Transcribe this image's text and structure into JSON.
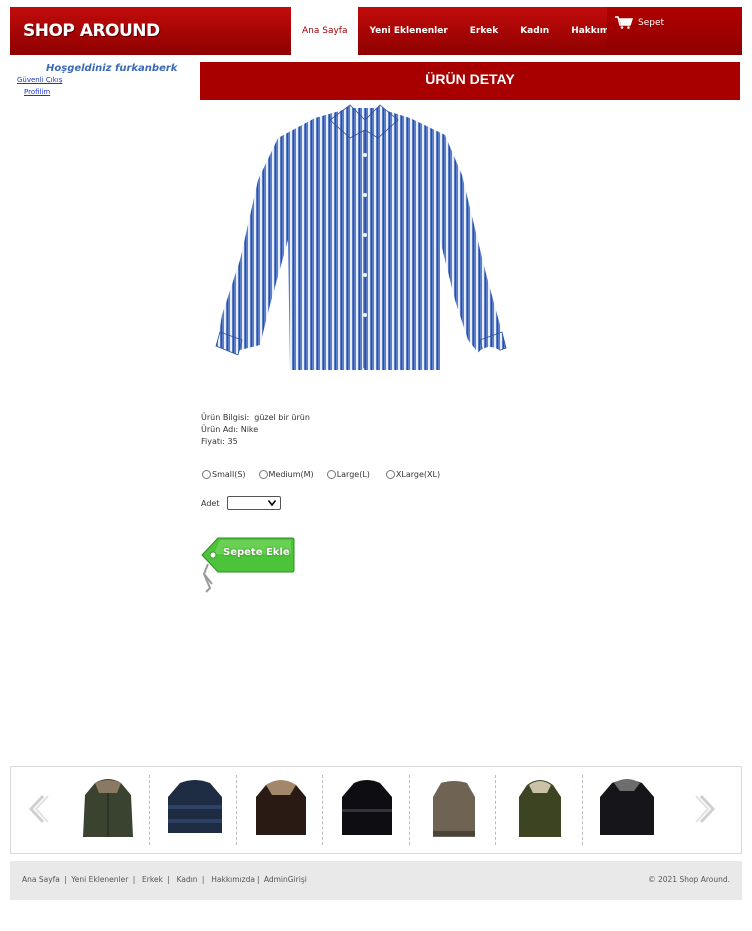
{
  "header": {
    "logo": "SHOP AROUND",
    "nav": [
      "Ana Sayfa",
      "Yeni Eklenenler",
      "Erkek",
      "Kadın",
      "Hakkımızda"
    ],
    "cart_label": "Sepet"
  },
  "sidebar": {
    "welcome": "Hoşgeldiniz furkanberk",
    "logout": "Güvenli Çıkış",
    "profile": "Profilim"
  },
  "main": {
    "title": "ÜRÜN DETAY",
    "info_label": "Ürün Bilgisi:",
    "info_value": "güzel bir ürün",
    "name_label": "Ürün Adı:",
    "name_value": "Nike",
    "price_label": "Fiyatı:",
    "price_value": "35",
    "sizes": [
      "Small(S)",
      "Medium(M)",
      "Large(L)",
      "XLarge(XL)"
    ],
    "qty_label": "Adet",
    "add_to_cart": "Sepete Ekle"
  },
  "footer": {
    "links": [
      "Ana Sayfa",
      "Yeni Eklenenler",
      "Erkek",
      "Kadın",
      "Hakkımızda",
      "AdminGirişi"
    ],
    "copyright": "© 2021 Shop Around."
  },
  "colors": {
    "brand_red": "#a80000",
    "link_blue": "#1a37c8",
    "welcome_blue": "#3a6ab8",
    "button_green": "#4cc43a"
  }
}
